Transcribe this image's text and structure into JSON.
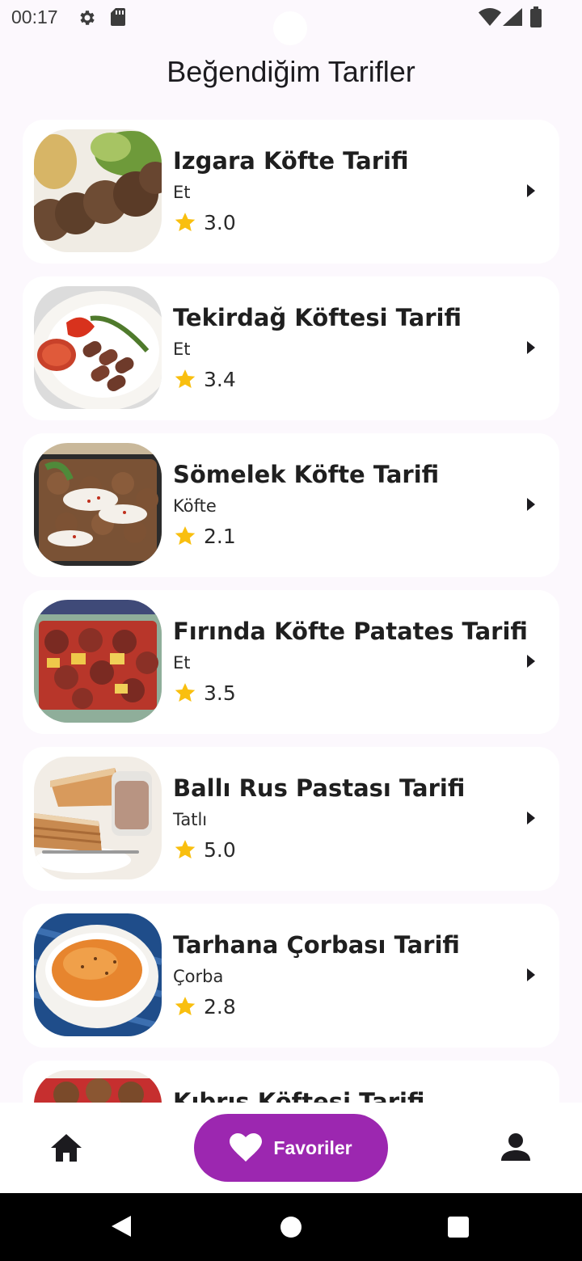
{
  "status_bar": {
    "time": "00:17",
    "icons": [
      "settings-icon",
      "sd-card-icon",
      "wifi-icon",
      "cell-signal-icon",
      "battery-icon"
    ]
  },
  "page": {
    "title": "Beğendiğim Tarifler"
  },
  "recipes": [
    {
      "title": "Izgara Köfte Tarifi",
      "category": "Et",
      "rating": "3.0"
    },
    {
      "title": "Tekirdağ Köftesi Tarifi",
      "category": "Et",
      "rating": "3.4"
    },
    {
      "title": "Sömelek Köfte Tarifi",
      "category": "Köfte",
      "rating": "2.1"
    },
    {
      "title": "Fırında Köfte Patates Tarifi",
      "category": "Et",
      "rating": "3.5"
    },
    {
      "title": "Ballı Rus Pastası Tarifi",
      "category": "Tatlı",
      "rating": "5.0"
    },
    {
      "title": "Tarhana Çorbası Tarifi",
      "category": "Çorba",
      "rating": "2.8"
    },
    {
      "title": "Kıbrıs Köftesi Tarifi",
      "category": "",
      "rating": ""
    }
  ],
  "bottom_nav": {
    "home_icon": "home-icon",
    "favorites_label": "Favoriler",
    "favorites_icon": "heart-icon",
    "profile_icon": "person-icon"
  },
  "colors": {
    "accent": "#9c27b0",
    "star": "#f9bf0f",
    "background": "#fcf8fd",
    "card": "#ffffff"
  }
}
